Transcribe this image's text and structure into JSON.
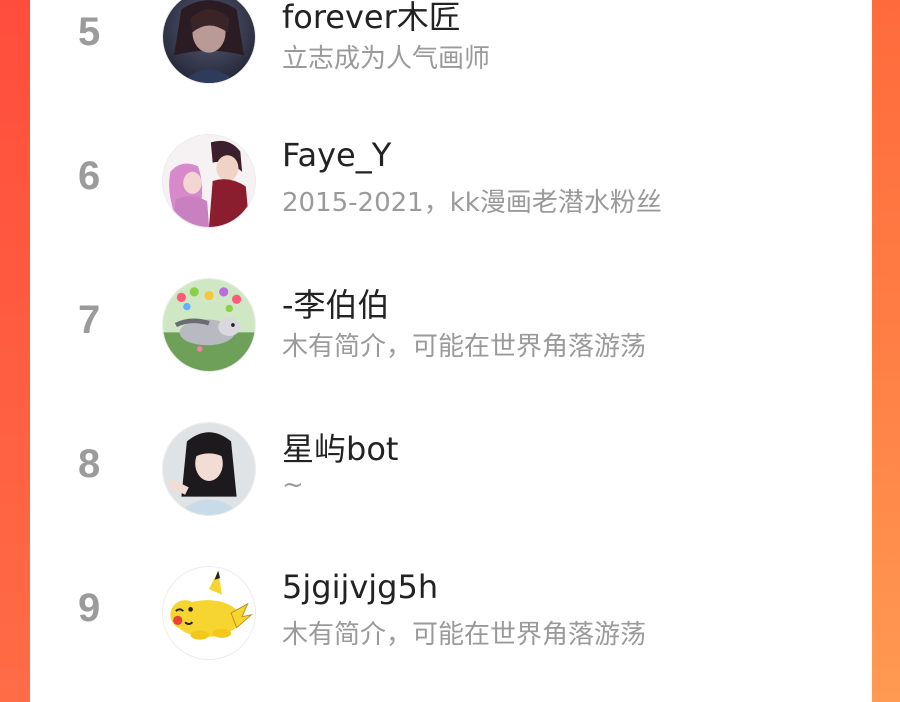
{
  "ranking": {
    "items": [
      {
        "rank": "5",
        "name": "forever木匠",
        "bio": "立志成为人气画师",
        "avatar_icon": "dark-portrait-avatar-icon"
      },
      {
        "rank": "6",
        "name": "Faye_Y",
        "bio": "2015-2021，kk漫画老潜水粉丝",
        "avatar_icon": "anime-couple-avatar-icon"
      },
      {
        "rank": "7",
        "name": "-李伯伯",
        "bio": "木有简介，可能在世界角落游荡",
        "avatar_icon": "bunny-hearts-avatar-icon"
      },
      {
        "rank": "8",
        "name": "星屿bot",
        "bio": "~",
        "avatar_icon": "girl-photo-avatar-icon"
      },
      {
        "rank": "9",
        "name": "5jgijvjg5h",
        "bio": "木有简介，可能在世界角落游荡",
        "avatar_icon": "pikachu-avatar-icon"
      }
    ]
  },
  "colors": {
    "background_accent": "#ff5a3c",
    "rank_number": "#9b9b9b",
    "name_text": "#222222",
    "bio_text": "#9a9a9a",
    "card": "#ffffff"
  }
}
